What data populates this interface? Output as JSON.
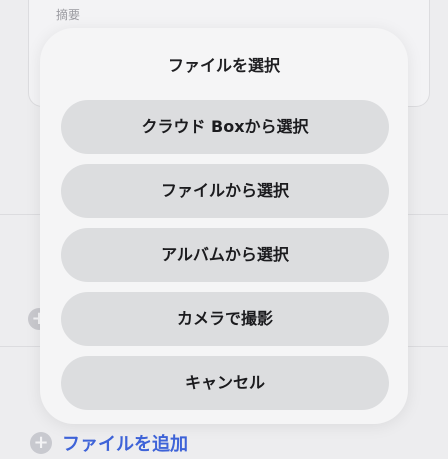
{
  "background": {
    "summary_label": "摘要",
    "add_file_link": "ファイルを追加"
  },
  "sheet": {
    "title": "ファイルを選択",
    "options": [
      "クラウド Boxから選択",
      "ファイルから選択",
      "アルバムから選択",
      "カメラで撮影"
    ],
    "cancel": "キャンセル"
  },
  "colors": {
    "accent": "#3e63d8",
    "sheet_bg": "#f5f5f6",
    "button_bg": "#dcdddf"
  }
}
